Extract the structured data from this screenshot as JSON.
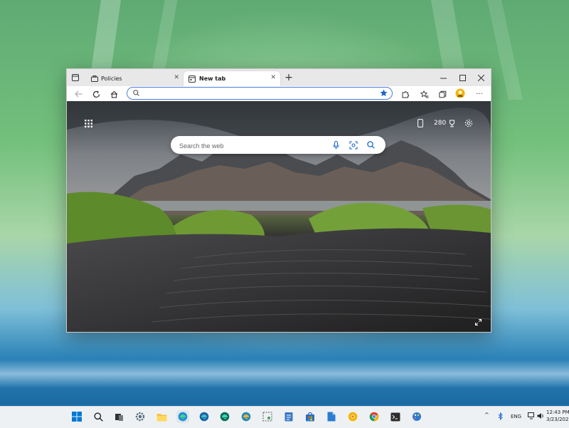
{
  "browser": {
    "tabs": [
      {
        "label": "Policies",
        "active": false,
        "icon": "briefcase-icon"
      },
      {
        "label": "New tab",
        "active": true,
        "icon": "new-tab-page-icon"
      }
    ],
    "new_tab_symbol": "+",
    "close_symbol": "✕",
    "address_value": "",
    "accent": "#0067c0"
  },
  "newtab": {
    "search_placeholder": "Search the web",
    "rewards_points": "280"
  },
  "taskbar": {
    "language": "ENG",
    "time": "12:43 PM",
    "date": "3/23/2023"
  }
}
